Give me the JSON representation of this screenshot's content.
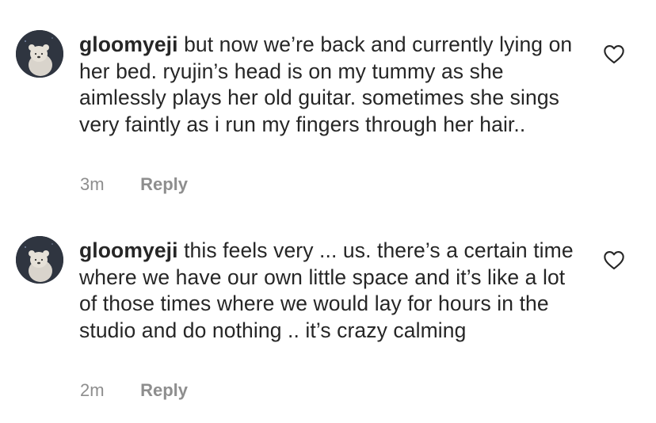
{
  "comments": [
    {
      "username": "gloomyeji",
      "text": "but now we’re back and currently lying on her bed. ryujin’s head is on my tummy as she aimlessly plays her old guitar. sometimes she sings very faintly as i run my fingers through her hair..",
      "time": "3m",
      "reply_label": "Reply",
      "like_icon": "heart-outline-icon"
    },
    {
      "username": "gloomyeji",
      "text": "this feels very ... us. there’s a certain time where we have our own little space and it’s like a lot of those times where we would lay for hours in the studio and do nothing .. it’s crazy calming",
      "time": "2m",
      "reply_label": "Reply",
      "like_icon": "heart-outline-icon"
    }
  ]
}
